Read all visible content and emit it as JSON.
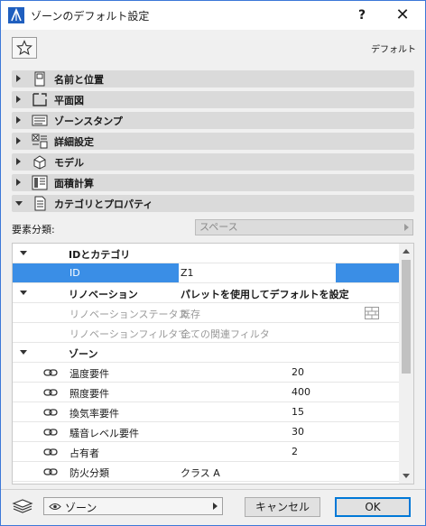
{
  "window": {
    "title": "ゾーンのデフォルト設定",
    "help": "?",
    "close": "✕"
  },
  "toolbar": {
    "default_label": "デフォルト"
  },
  "sections": [
    {
      "label": "名前と位置",
      "icon": "name-position-icon",
      "expanded": false
    },
    {
      "label": "平面図",
      "icon": "floor-plan-icon",
      "expanded": false
    },
    {
      "label": "ゾーンスタンプ",
      "icon": "zone-stamp-icon",
      "expanded": false
    },
    {
      "label": "詳細設定",
      "icon": "detail-settings-icon",
      "expanded": false
    },
    {
      "label": "モデル",
      "icon": "model-icon",
      "expanded": false
    },
    {
      "label": "面積計算",
      "icon": "area-calc-icon",
      "expanded": false
    },
    {
      "label": "カテゴリとプロパティ",
      "icon": "category-properties-icon",
      "expanded": true
    }
  ],
  "classification": {
    "label": "要素分類:",
    "value": "スペース"
  },
  "table": {
    "id_group": "IDとカテゴリ",
    "id_label": "ID",
    "id_value": "Z1",
    "renovation_group": "リノベーション",
    "renovation_group_value": "パレットを使用してデフォルトを設定",
    "renovation_status_label": "リノベーションステータス",
    "renovation_status_value": "既存",
    "renovation_filter_label": "リノベーションフィルタで…",
    "renovation_filter_value": "全ての関連フィルタ",
    "zone_group": "ゾーン",
    "zone_rows": [
      {
        "label": "温度要件",
        "value": "20"
      },
      {
        "label": "照度要件",
        "value": "400"
      },
      {
        "label": "換気率要件",
        "value": "15"
      },
      {
        "label": "騒音レベル要件",
        "value": "30"
      },
      {
        "label": "占有者",
        "value": "2"
      },
      {
        "label": "防火分類",
        "value": "クラス A"
      }
    ]
  },
  "footer": {
    "layer": "ゾーン",
    "cancel": "キャンセル",
    "ok": "OK"
  },
  "colors": {
    "accent": "#3a8ee6",
    "section_bg": "#dadada",
    "border": "#3c78d8"
  }
}
